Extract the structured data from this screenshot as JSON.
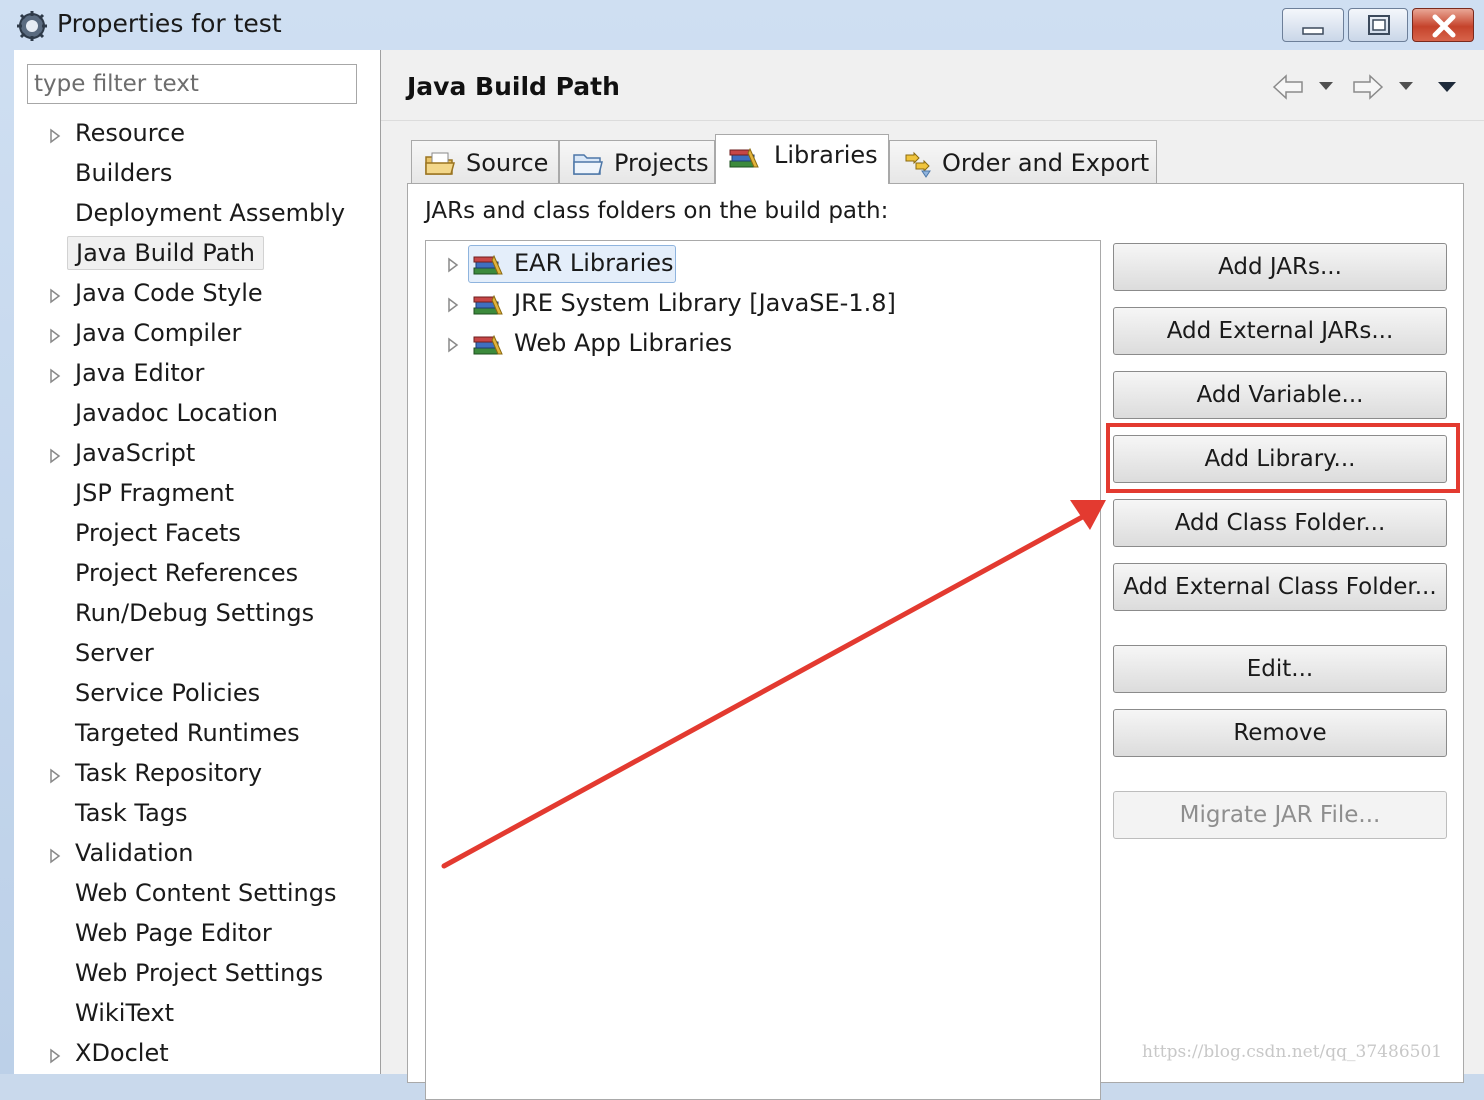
{
  "window": {
    "title": "Properties for test",
    "icon": "gear-icon",
    "controls": [
      "minimize-icon",
      "maximize-icon",
      "close-icon"
    ]
  },
  "filter": {
    "placeholder": "type filter text",
    "value": ""
  },
  "tree": {
    "items": [
      {
        "label": "Resource",
        "expandable": true
      },
      {
        "label": "Builders",
        "expandable": false
      },
      {
        "label": "Deployment Assembly",
        "expandable": false
      },
      {
        "label": "Java Build Path",
        "expandable": false,
        "selected": true
      },
      {
        "label": "Java Code Style",
        "expandable": true
      },
      {
        "label": "Java Compiler",
        "expandable": true
      },
      {
        "label": "Java Editor",
        "expandable": true
      },
      {
        "label": "Javadoc Location",
        "expandable": false
      },
      {
        "label": "JavaScript",
        "expandable": true
      },
      {
        "label": "JSP Fragment",
        "expandable": false
      },
      {
        "label": "Project Facets",
        "expandable": false
      },
      {
        "label": "Project References",
        "expandable": false
      },
      {
        "label": "Run/Debug Settings",
        "expandable": false
      },
      {
        "label": "Server",
        "expandable": false
      },
      {
        "label": "Service Policies",
        "expandable": false
      },
      {
        "label": "Targeted Runtimes",
        "expandable": false
      },
      {
        "label": "Task Repository",
        "expandable": true
      },
      {
        "label": "Task Tags",
        "expandable": false
      },
      {
        "label": "Validation",
        "expandable": true
      },
      {
        "label": "Web Content Settings",
        "expandable": false
      },
      {
        "label": "Web Page Editor",
        "expandable": false
      },
      {
        "label": "Web Project Settings",
        "expandable": false
      },
      {
        "label": "WikiText",
        "expandable": false
      },
      {
        "label": "XDoclet",
        "expandable": true
      }
    ]
  },
  "page": {
    "title": "Java Build Path",
    "nav": [
      "back-arrow-icon",
      "dropdown-icon",
      "forward-arrow-icon",
      "dropdown-icon",
      "menu-dropdown-icon"
    ]
  },
  "tabs": [
    {
      "label": "Source",
      "icon": "source-folder-icon",
      "active": false
    },
    {
      "label": "Projects",
      "icon": "project-folder-icon",
      "active": false
    },
    {
      "label": "Libraries",
      "icon": "library-icon",
      "active": true
    },
    {
      "label": "Order and Export",
      "icon": "order-export-icon",
      "active": false
    }
  ],
  "libraries": {
    "section_label": "JARs and class folders on the build path:",
    "items": [
      {
        "label": "EAR Libraries",
        "selected": true
      },
      {
        "label": "JRE System Library [JavaSE-1.8]",
        "selected": false
      },
      {
        "label": "Web App Libraries",
        "selected": false
      }
    ]
  },
  "buttons": [
    {
      "label": "Add JARs...",
      "enabled": true
    },
    {
      "label": "Add External JARs...",
      "enabled": true
    },
    {
      "label": "Add Variable...",
      "enabled": true
    },
    {
      "label": "Add Library...",
      "enabled": true,
      "highlighted": true
    },
    {
      "label": "Add Class Folder...",
      "enabled": true
    },
    {
      "label": "Add External Class Folder...",
      "enabled": true
    },
    {
      "label": "Edit...",
      "enabled": true
    },
    {
      "label": "Remove",
      "enabled": true
    },
    {
      "label": "Migrate JAR File...",
      "enabled": false
    }
  ],
  "annotation": {
    "color": "#e33a30"
  },
  "watermark": "https://blog.csdn.net/qq_37486501"
}
